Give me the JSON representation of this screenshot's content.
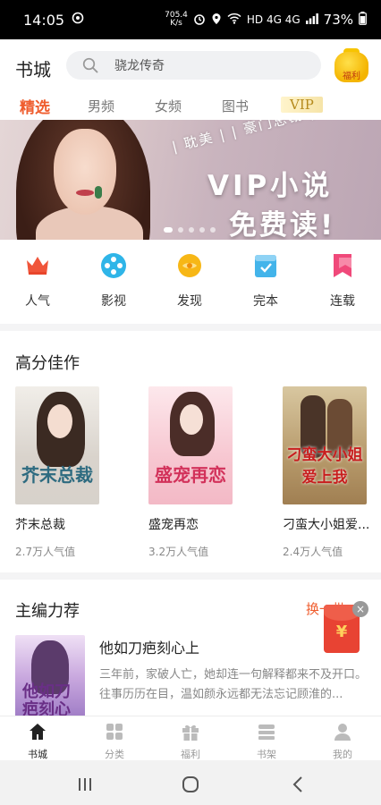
{
  "status_bar": {
    "time": "14:05",
    "speed_value": "705.4",
    "speed_unit": "K/s",
    "network": "HD 4G 4G",
    "battery": "73%"
  },
  "header": {
    "title": "书城",
    "search_placeholder": "骁龙传奇",
    "welfare_label": "福利"
  },
  "tabs": [
    {
      "label": "精选",
      "active": true
    },
    {
      "label": "男频"
    },
    {
      "label": "女频"
    },
    {
      "label": "图书"
    },
    {
      "label": "VIP"
    }
  ],
  "banner": {
    "tags": "| 耽美 | | 豪门总裁 | | 现代都市 |",
    "title_line1": "VIP小说",
    "title_line2": "免费读!",
    "page_count": 5,
    "active_page": 1
  },
  "categories": [
    {
      "label": "人气",
      "icon": "crown-icon",
      "color": "#f0553a"
    },
    {
      "label": "影视",
      "icon": "film-reel-icon",
      "color": "#2fb5e8"
    },
    {
      "label": "发现",
      "icon": "discover-icon",
      "color": "#f7b716"
    },
    {
      "label": "完本",
      "icon": "finished-book-icon",
      "color": "#43b4ea"
    },
    {
      "label": "连载",
      "icon": "serial-bookmark-icon",
      "color": "#f0497a"
    }
  ],
  "high_score": {
    "title": "高分佳作",
    "books": [
      {
        "title": "芥末总裁",
        "cover_text": "芥末总裁",
        "popularity": "2.7万人气值"
      },
      {
        "title": "盛宠再恋",
        "cover_text": "盛宠再恋",
        "popularity": "3.2万人气值"
      },
      {
        "title": "刁蛮大小姐爱...",
        "cover_text": "刁蛮大小姐爱上我",
        "popularity": "2.4万人气值"
      }
    ]
  },
  "editor_picks": {
    "title": "主编力荐",
    "swap_label": "换一批",
    "book": {
      "title": "他如刀疤刻心上",
      "cover_text": "他如刀疤刻心上",
      "description": "三年前，家破人亡，她却连一句解释都来不及开口。往事历历在目，温如颜永远都无法忘记顾淮的..."
    }
  },
  "red_packet": {
    "symbol": "¥",
    "close": "×"
  },
  "bottom_nav": [
    {
      "label": "书城",
      "icon": "home-icon",
      "active": true
    },
    {
      "label": "分类",
      "icon": "grid-icon"
    },
    {
      "label": "福利",
      "icon": "gift-icon"
    },
    {
      "label": "书架",
      "icon": "bookshelf-icon"
    },
    {
      "label": "我的",
      "icon": "profile-icon"
    }
  ],
  "colors": {
    "accent": "#ef5d2e",
    "vip_gold": "#b58a1c"
  }
}
